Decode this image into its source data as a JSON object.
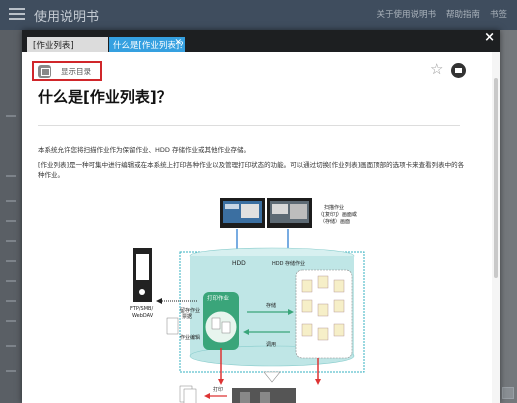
{
  "background": {
    "app_title": "使用说明书",
    "header_links": [
      "关于使用说明书",
      "帮助指南",
      "书签"
    ]
  },
  "modal": {
    "tabs": [
      {
        "label": "[作业列表]"
      },
      {
        "label": "什么是[作业列表]？"
      }
    ],
    "toc_button": "显示目录",
    "title": "什么是[作业列表]？",
    "paragraphs": [
      "本系统允许您将扫描作业作为保留作业、HDD 存储作业或其他作业存储。",
      "[作业列表]是一种可集中进行编辑或在本系统上打印各种作业以及管理打印状态的功能。可以通过切换[作业列表]画面顶部的选项卡来查看列表中的各种作业。"
    ]
  },
  "diagram": {
    "scan_label": "扫描作业\n（[复印]）画面或\n（存储）画面",
    "hdd_label": "HDD",
    "hdd_store_label": "HDD 存储作业",
    "print_job_label": "打印作业",
    "save_label": "存储",
    "recall_label": "调用",
    "server_label": "FTP/SMB/\nWebDAV",
    "job_ticket_label": "留存作业\n票据",
    "job_edit_label": "作业编辑",
    "print_label": "打印"
  },
  "colors": {
    "accent_tab": "#35a0e0",
    "highlight_box": "#d0262a",
    "hdd_fill": "#bfe6e6"
  }
}
